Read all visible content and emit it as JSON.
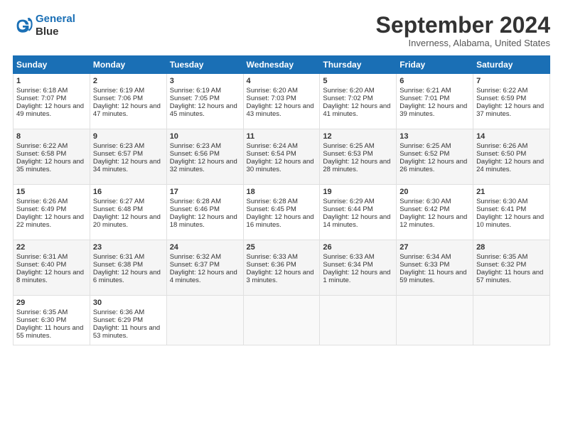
{
  "header": {
    "logo_line1": "General",
    "logo_line2": "Blue",
    "month": "September 2024",
    "location": "Inverness, Alabama, United States"
  },
  "days_of_week": [
    "Sunday",
    "Monday",
    "Tuesday",
    "Wednesday",
    "Thursday",
    "Friday",
    "Saturday"
  ],
  "weeks": [
    [
      {
        "day": 1,
        "rise": "6:18 AM",
        "set": "7:07 PM",
        "daylight": "12 hours and 49 minutes."
      },
      {
        "day": 2,
        "rise": "6:19 AM",
        "set": "7:06 PM",
        "daylight": "12 hours and 47 minutes."
      },
      {
        "day": 3,
        "rise": "6:19 AM",
        "set": "7:05 PM",
        "daylight": "12 hours and 45 minutes."
      },
      {
        "day": 4,
        "rise": "6:20 AM",
        "set": "7:03 PM",
        "daylight": "12 hours and 43 minutes."
      },
      {
        "day": 5,
        "rise": "6:20 AM",
        "set": "7:02 PM",
        "daylight": "12 hours and 41 minutes."
      },
      {
        "day": 6,
        "rise": "6:21 AM",
        "set": "7:01 PM",
        "daylight": "12 hours and 39 minutes."
      },
      {
        "day": 7,
        "rise": "6:22 AM",
        "set": "6:59 PM",
        "daylight": "12 hours and 37 minutes."
      }
    ],
    [
      {
        "day": 8,
        "rise": "6:22 AM",
        "set": "6:58 PM",
        "daylight": "12 hours and 35 minutes."
      },
      {
        "day": 9,
        "rise": "6:23 AM",
        "set": "6:57 PM",
        "daylight": "12 hours and 34 minutes."
      },
      {
        "day": 10,
        "rise": "6:23 AM",
        "set": "6:56 PM",
        "daylight": "12 hours and 32 minutes."
      },
      {
        "day": 11,
        "rise": "6:24 AM",
        "set": "6:54 PM",
        "daylight": "12 hours and 30 minutes."
      },
      {
        "day": 12,
        "rise": "6:25 AM",
        "set": "6:53 PM",
        "daylight": "12 hours and 28 minutes."
      },
      {
        "day": 13,
        "rise": "6:25 AM",
        "set": "6:52 PM",
        "daylight": "12 hours and 26 minutes."
      },
      {
        "day": 14,
        "rise": "6:26 AM",
        "set": "6:50 PM",
        "daylight": "12 hours and 24 minutes."
      }
    ],
    [
      {
        "day": 15,
        "rise": "6:26 AM",
        "set": "6:49 PM",
        "daylight": "12 hours and 22 minutes."
      },
      {
        "day": 16,
        "rise": "6:27 AM",
        "set": "6:48 PM",
        "daylight": "12 hours and 20 minutes."
      },
      {
        "day": 17,
        "rise": "6:28 AM",
        "set": "6:46 PM",
        "daylight": "12 hours and 18 minutes."
      },
      {
        "day": 18,
        "rise": "6:28 AM",
        "set": "6:45 PM",
        "daylight": "12 hours and 16 minutes."
      },
      {
        "day": 19,
        "rise": "6:29 AM",
        "set": "6:44 PM",
        "daylight": "12 hours and 14 minutes."
      },
      {
        "day": 20,
        "rise": "6:30 AM",
        "set": "6:42 PM",
        "daylight": "12 hours and 12 minutes."
      },
      {
        "day": 21,
        "rise": "6:30 AM",
        "set": "6:41 PM",
        "daylight": "12 hours and 10 minutes."
      }
    ],
    [
      {
        "day": 22,
        "rise": "6:31 AM",
        "set": "6:40 PM",
        "daylight": "12 hours and 8 minutes."
      },
      {
        "day": 23,
        "rise": "6:31 AM",
        "set": "6:38 PM",
        "daylight": "12 hours and 6 minutes."
      },
      {
        "day": 24,
        "rise": "6:32 AM",
        "set": "6:37 PM",
        "daylight": "12 hours and 4 minutes."
      },
      {
        "day": 25,
        "rise": "6:33 AM",
        "set": "6:36 PM",
        "daylight": "12 hours and 3 minutes."
      },
      {
        "day": 26,
        "rise": "6:33 AM",
        "set": "6:34 PM",
        "daylight": "12 hours and 1 minute."
      },
      {
        "day": 27,
        "rise": "6:34 AM",
        "set": "6:33 PM",
        "daylight": "11 hours and 59 minutes."
      },
      {
        "day": 28,
        "rise": "6:35 AM",
        "set": "6:32 PM",
        "daylight": "11 hours and 57 minutes."
      }
    ],
    [
      {
        "day": 29,
        "rise": "6:35 AM",
        "set": "6:30 PM",
        "daylight": "11 hours and 55 minutes."
      },
      {
        "day": 30,
        "rise": "6:36 AM",
        "set": "6:29 PM",
        "daylight": "11 hours and 53 minutes."
      },
      null,
      null,
      null,
      null,
      null
    ]
  ]
}
